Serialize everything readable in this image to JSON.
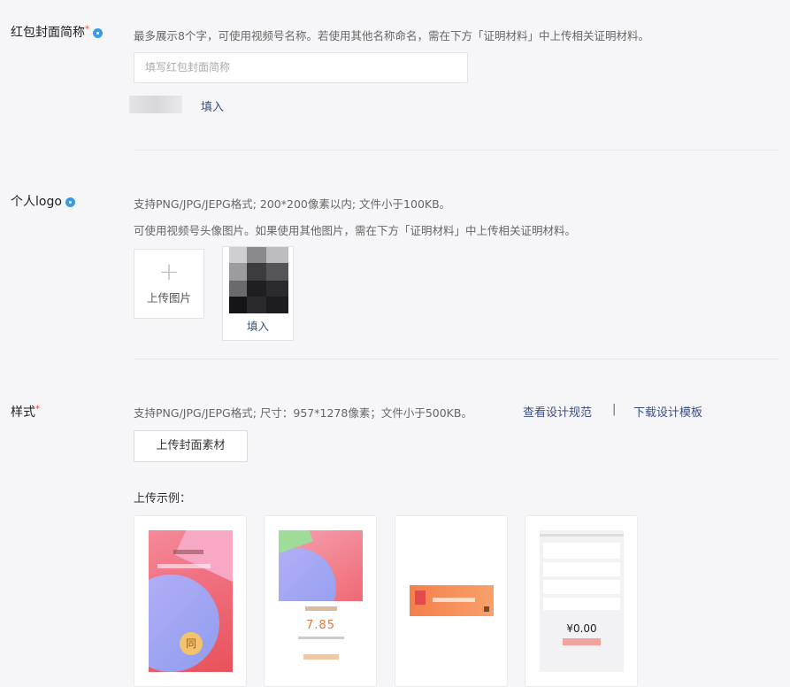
{
  "cover_name": {
    "label": "红包封面简称",
    "required_mark": "*",
    "hint": "最多展示8个字，可使用视频号名称。若使用其他名称命名，需在下方「证明材料」中上传相关证明材料。",
    "placeholder": "填写红包封面简称",
    "fill_link": "填入"
  },
  "logo": {
    "label": "个人logo",
    "hint_line1": "支持PNG/JPG/JEPG格式; 200*200像素以内; 文件小于100KB。",
    "hint_line2": "可使用视频号头像图片。如果使用其他图片，需在下方「证明材料」中上传相关证明材料。",
    "upload_plus": "+",
    "upload_label": "上传图片",
    "fill_link": "填入"
  },
  "style": {
    "label": "样式",
    "required_mark": "*",
    "hint": "支持PNG/JPG/JEPG格式; 尺寸：957*1278像素；文件小于500KB。",
    "spec_link": "查看设计规范",
    "separator": "|",
    "template_link": "下载设计模板",
    "upload_button": "上传封面素材",
    "examples_title": "上传示例："
  },
  "examples": {
    "ex1": {
      "badge": "同"
    },
    "ex2": {
      "amount": "7.85"
    },
    "ex4": {
      "amount": "¥0.00"
    }
  },
  "colors": {
    "accent_blue": "#3a9ae8",
    "link": "#3c4f86",
    "required": "#e64340",
    "background": "#f6f6f8"
  }
}
